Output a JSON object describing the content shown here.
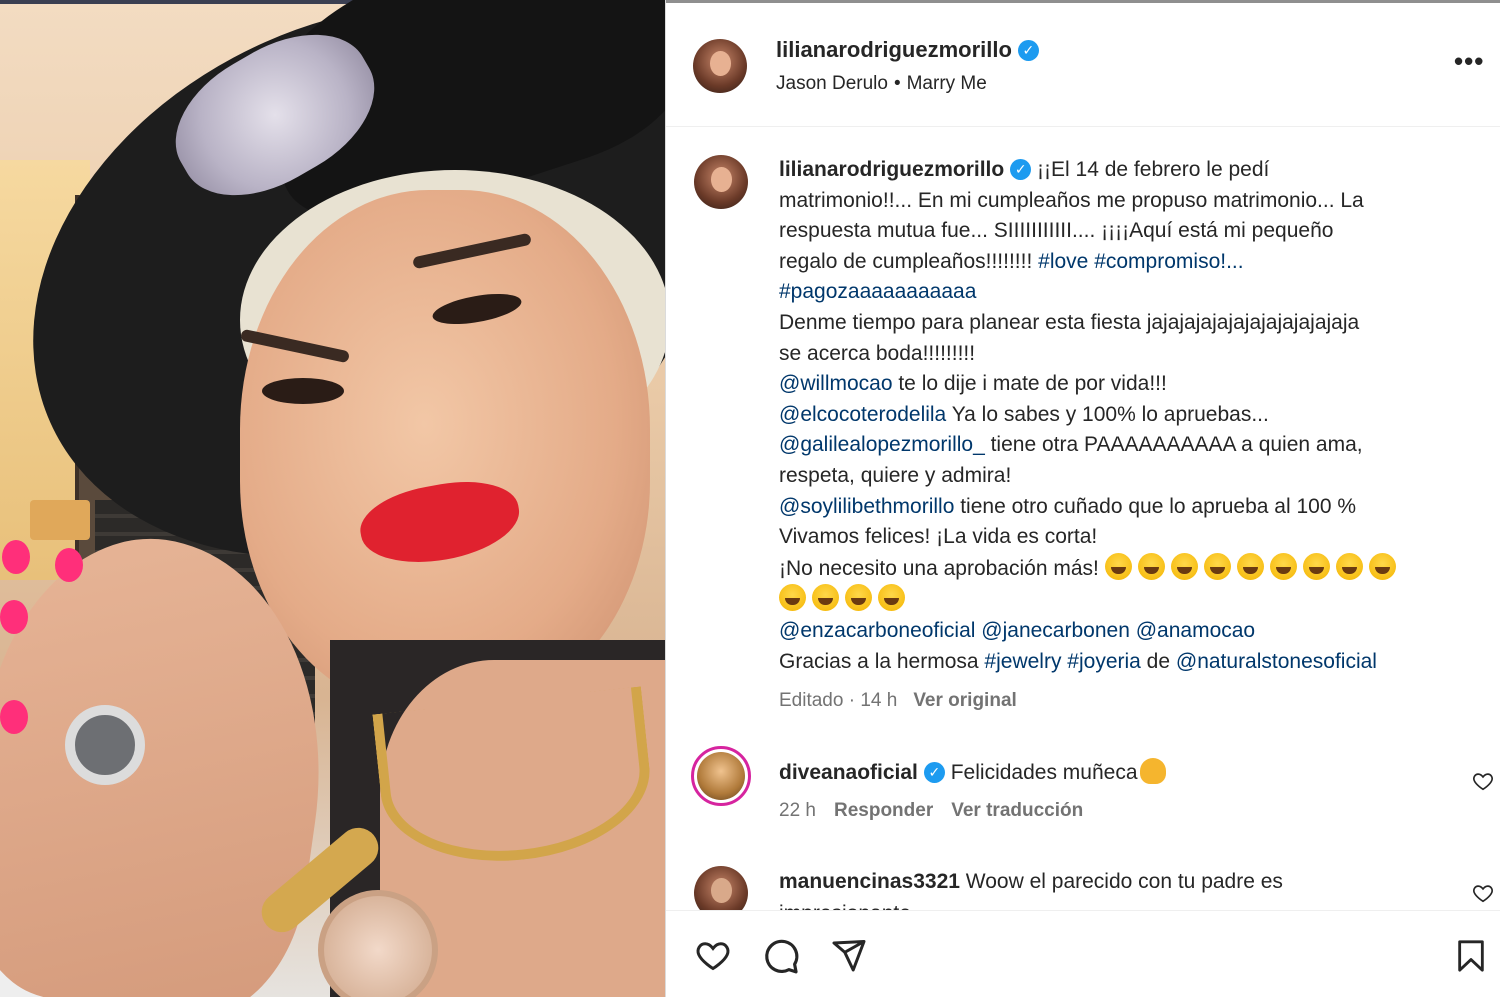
{
  "post": {
    "username": "lilianarodriguezmorillo",
    "verified": true,
    "audio_artist": "Jason Derulo",
    "audio_separator": "•",
    "audio_track": "Marry Me",
    "more_label": "•••"
  },
  "caption": {
    "username": "lilianarodriguezmorillo",
    "line1": "¡¡El 14 de febrero le pedí",
    "line2": "matrimonio!!... En mi cumpleaños me propuso matrimonio... La",
    "line3": "respuesta mutua fue... SIIIIIIIIIII.... ¡¡¡¡Aquí está mi pequeño",
    "line4_text": "regalo de cumpleaños!!!!!!!! ",
    "line4_tag1": "#love",
    "line4_tag2": "#compromiso!...",
    "line5_tag": "#pagozaaaaaaaaaaa",
    "line6": "Denme tiempo para planear esta fiesta jajajajajajajajajajajajaja",
    "line7": "se acerca boda!!!!!!!!!",
    "mention1": "@willmocao",
    "mention1_text": " te lo dije i mate de por vida!!!",
    "mention2": "@elcocoterodelila",
    "mention2_text": " Ya lo sabes y 100% lo apruebas...",
    "mention3": "@galilealopezmorillo_",
    "mention3_text": " tiene otra PAAAAAAAAAA a quien ama,",
    "line11": "respeta, quiere y admira!",
    "mention4": "@soylilibethmorillo",
    "mention4_text": " tiene otro cuñado que lo aprueba al 100 %",
    "line13": "Vivamos felices! ¡La vida es corta!",
    "line14": "¡No necesito una aprobación más! ",
    "mention5": "@enzacarboneoficial",
    "mention6": "@janecarbonen",
    "mention7": "@anamocao",
    "line17_text": "Gracias a la hermosa ",
    "tag_jewelry": "#jewelry",
    "tag_joyeria": "#joyeria",
    "line17_de": " de ",
    "mention8": "@naturalstonesoficial",
    "meta_edited": "Editado · 14 h",
    "meta_see_original": "Ver original"
  },
  "comments": [
    {
      "username": "diveanaoficial",
      "verified": true,
      "text": "Felicidades muñeca",
      "time": "22 h",
      "reply": "Responder",
      "translate": "Ver traducción"
    },
    {
      "username": "manuencinas3321",
      "text": "Woow el parecido con tu padre es",
      "text_cut": "impresionante"
    }
  ],
  "icons": {
    "like": "heart-icon",
    "comment": "comment-icon",
    "share": "share-icon",
    "save": "bookmark-icon"
  }
}
